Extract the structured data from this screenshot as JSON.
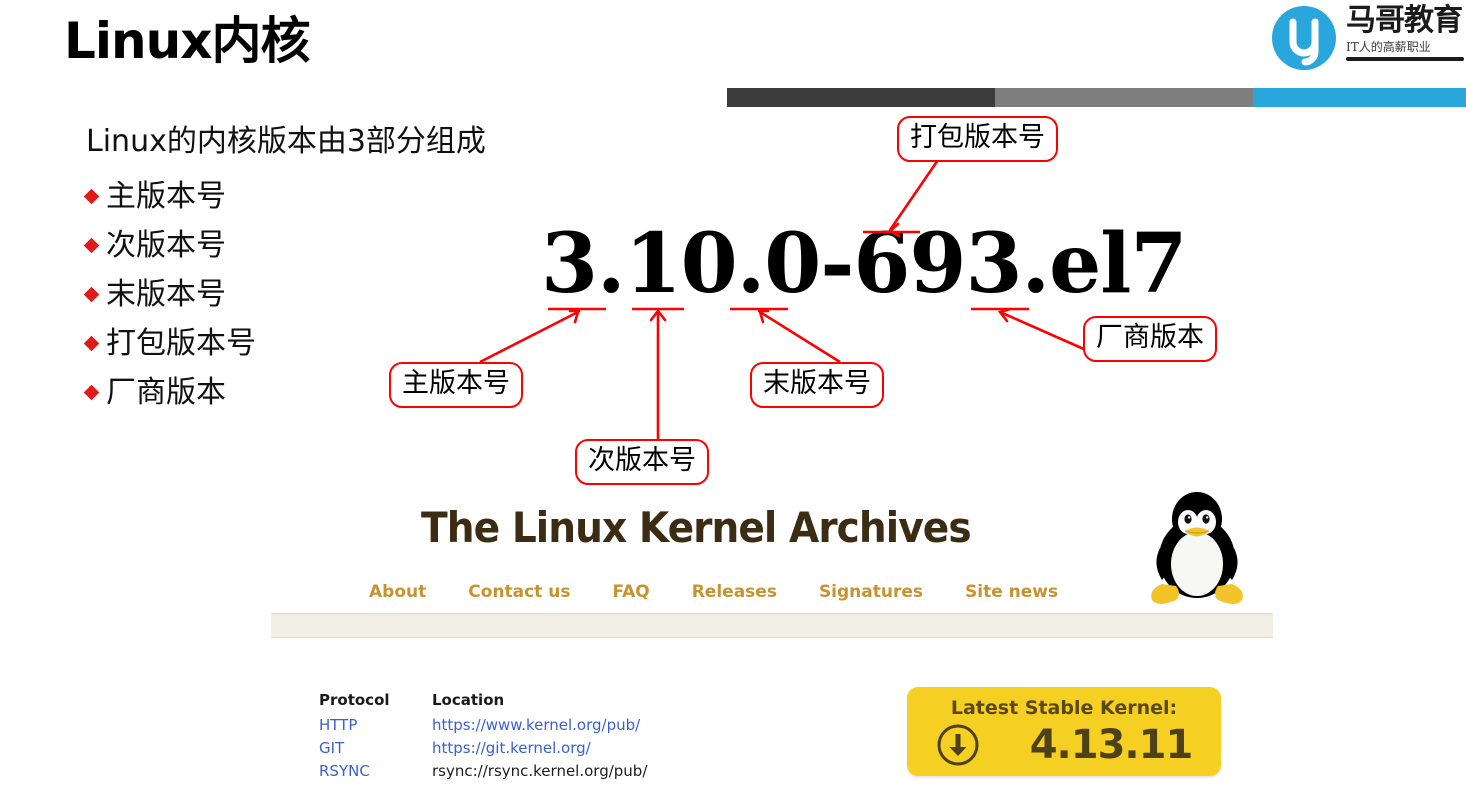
{
  "slide": {
    "title": "Linux内核",
    "lead": "Linux的内核版本由3部分组成",
    "bullets": [
      {
        "label": "主版本号"
      },
      {
        "label": "次版本号"
      },
      {
        "label": "末版本号"
      },
      {
        "label": "打包版本号"
      },
      {
        "label": "厂商版本"
      }
    ],
    "version_string": "3.10.0-693.el7"
  },
  "brand": {
    "name": "马哥教育",
    "tagline": "IT人的高薪职业",
    "logo_icon": "magedu-circle-logo"
  },
  "accent_bar": {
    "colors": [
      "#3c3c3c",
      "#7e7e7e",
      "#29a7dd"
    ]
  },
  "callouts": {
    "package": "打包版本号",
    "vendor": "厂商版本",
    "major": "主版本号",
    "minor": "次版本号",
    "patch": "末版本号"
  },
  "kernel_org": {
    "title": "The Linux Kernel Archives",
    "nav": [
      {
        "label": "About"
      },
      {
        "label": "Contact us"
      },
      {
        "label": "FAQ"
      },
      {
        "label": "Releases"
      },
      {
        "label": "Signatures"
      },
      {
        "label": "Site news"
      }
    ],
    "tux_icon": "tux-penguin-logo",
    "mirrors": {
      "headers": {
        "protocol": "Protocol",
        "location": "Location"
      },
      "rows": [
        {
          "protocol": "HTTP",
          "location": "https://www.kernel.org/pub/",
          "location_is_link": true
        },
        {
          "protocol": "GIT",
          "location": "https://git.kernel.org/",
          "location_is_link": true
        },
        {
          "protocol": "RSYNC",
          "location": "rsync://rsync.kernel.org/pub/",
          "location_is_link": false
        }
      ]
    },
    "stable": {
      "label": "Latest Stable Kernel:",
      "version": "4.13.11",
      "icon": "download-circle-icon",
      "color": "#f5cf22"
    }
  },
  "annotation_color": "#ff0000"
}
